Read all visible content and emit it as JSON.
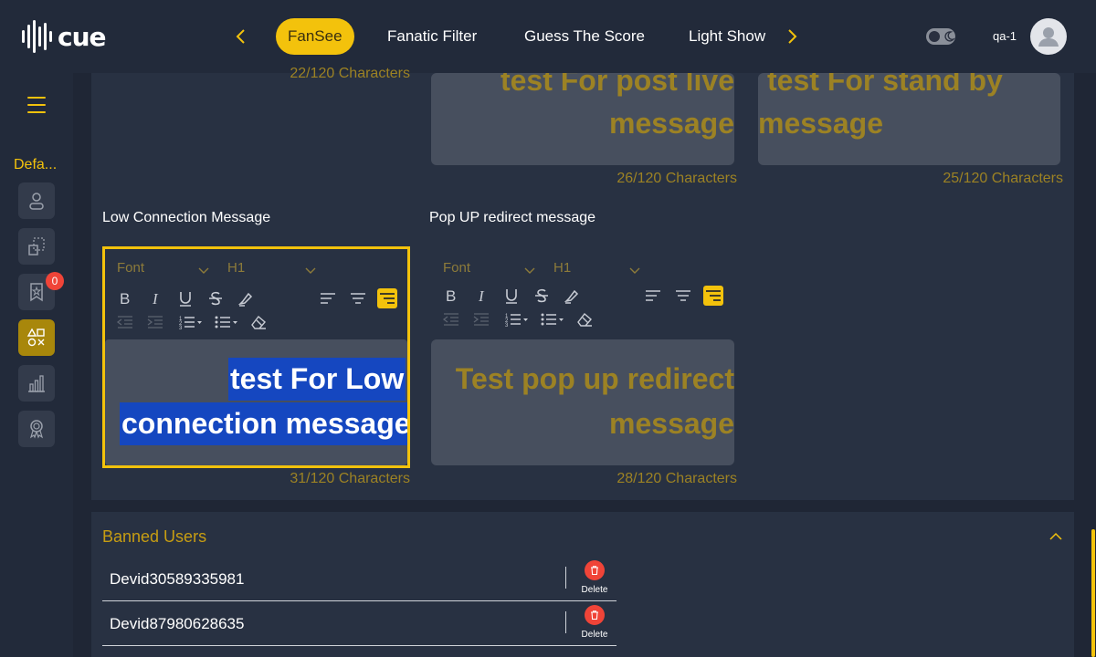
{
  "brand": {
    "logo_text": "cue"
  },
  "nav": {
    "items": [
      {
        "label": "FanSee",
        "active": true
      },
      {
        "label": "Fanatic Filter",
        "active": false
      },
      {
        "label": "Guess The Score",
        "active": false
      },
      {
        "label": "Light Show",
        "active": false
      }
    ]
  },
  "user": {
    "name": "qa-1"
  },
  "sidebar": {
    "label": "Defa...",
    "items": [
      {
        "icon": "user-icon"
      },
      {
        "icon": "layout-icon"
      },
      {
        "icon": "bookmark-star-icon",
        "badge": "0"
      },
      {
        "icon": "shapes-icon",
        "active": true
      },
      {
        "icon": "bar-chart-icon"
      },
      {
        "icon": "award-icon"
      }
    ]
  },
  "messages": {
    "top_left_count": "22/120 Characters",
    "post_live": {
      "line1": "test For post live",
      "line2": "message",
      "count": "26/120 Characters"
    },
    "stand_by": {
      "line1": "test For stand by",
      "line2": "message",
      "count": "25/120 Characters"
    },
    "low_connection": {
      "label": "Low Connection Message",
      "line1": "test For Low",
      "line2": "connection message",
      "count": "31/120 Characters"
    },
    "popup_redirect": {
      "label": "Pop UP redirect message",
      "line1": "Test pop up redirect",
      "line2": "message",
      "count": "28/120 Characters"
    }
  },
  "toolbar": {
    "font_label": "Font",
    "heading_label": "H1"
  },
  "banned": {
    "title": "Banned Users",
    "delete_label": "Delete",
    "users": [
      {
        "name": "Devid30589335981"
      },
      {
        "name": "Devid87980628635"
      }
    ]
  },
  "colors": {
    "accent": "#f3c20c",
    "background": "#1f2635",
    "panel": "#283142",
    "danger": "#f04438",
    "selection": "#1547c0"
  }
}
